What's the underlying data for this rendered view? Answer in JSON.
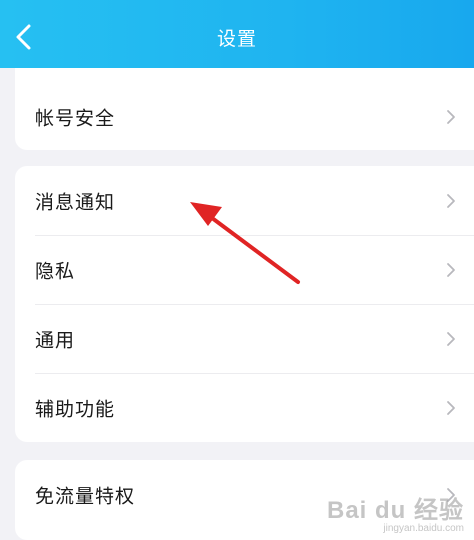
{
  "header": {
    "title": "设置",
    "back_icon": "chevron-left-icon",
    "gradient_colors": [
      "#26c0f2",
      "#18a8ee"
    ]
  },
  "groups": [
    {
      "items": [
        {
          "label": "帐号安全",
          "icon": "chevron-right-icon"
        }
      ]
    },
    {
      "items": [
        {
          "label": "消息通知",
          "icon": "chevron-right-icon"
        },
        {
          "label": "隐私",
          "icon": "chevron-right-icon"
        },
        {
          "label": "通用",
          "icon": "chevron-right-icon"
        },
        {
          "label": "辅助功能",
          "icon": "chevron-right-icon"
        }
      ]
    },
    {
      "items": [
        {
          "label": "免流量特权",
          "icon": "chevron-right-icon"
        }
      ]
    }
  ],
  "annotation": {
    "color": "#e02424",
    "points_to": "消息通知"
  },
  "watermark": {
    "brand": "Bai du 经验",
    "url": "jingyan.baidu.com"
  }
}
